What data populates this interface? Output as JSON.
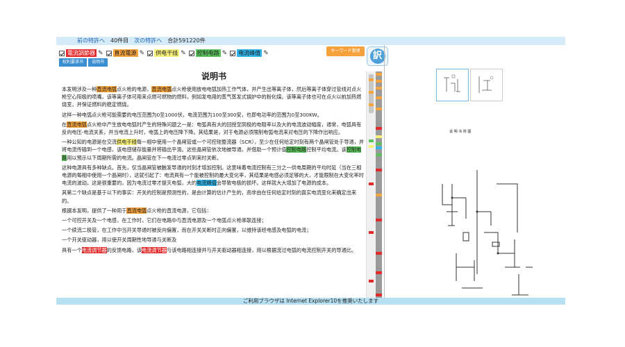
{
  "nav": {
    "prev": "前の特許へ",
    "position": "40件目",
    "next": "次の特許へ",
    "total": "合計591220件"
  },
  "legend": [
    {
      "label": "電流調節器",
      "color": "#e32929"
    },
    {
      "label": "直流電源",
      "color": "#f6a43e"
    },
    {
      "label": "供电干线",
      "color": "#f6f07a"
    },
    {
      "label": "控制电路",
      "color": "#5bc25b"
    },
    {
      "label": "电流峰值",
      "color": "#2fb3e8"
    }
  ],
  "keyword_button": "キーワード管理",
  "translate_icon": "訳",
  "tabs": {
    "claims": "权利要求书",
    "description": "说明书"
  },
  "doc": {
    "title": "说明书",
    "p1": {
      "a": "本发明涉及一种",
      "h1": "直流电弧",
      "b": "点火枪的电源，",
      "h2": "直流电弧",
      "c": "点火枪使用放电电弧加热工作气体，并产生出等离子体，然后等离子体穿过管线对点火枪空心阳极的喷嘴，该等离子体可用来点燃可燃物的燃料，例如发电用的蒸气蒸发式锅炉中的粉化煤。该等离子体也可在点火以前加热燃烧室，并保证燃料的稳定燃烧。"
    },
    "p2": "这样一种电弧点火枪可能需要的电压范围为0至1000伏，电流范围为100至300安，也即电功率的范围为0至300KW。",
    "p3": {
      "a": "在",
      "h1": "直流电弧",
      "b": "点火枪中产生放电电弧时产生的特殊问题之一是：电弧具有大的回授至阴极的电阻率以及大的电流波动幅度，通常，电弧具有反向电压-电流关系，并当电流上升时，电弧上的电压降下降。其结果是，对于电源必须限制电弧电流来对电压的下降作出响应。"
    },
    "p4": {
      "a": "一种公知的电源是在交流",
      "h1": "供电干线",
      "b": "每一相中使用一个晶闸管或一个可控硅整流器（SCR），至少在任何给定时刻有两个晶闸管处于导通，并将电流传输到一个电感，该电感储存能量并将输出平滑。这些晶闸管依次地被导通，并借助一个预计值",
      "h2": "控制电路",
      "c": "控制平均电流。该",
      "h3": "控制电路",
      "d": "用以预示以下周期所需的电流。晶闸管在下一电流过零点到来时关断。"
    },
    "p5": {
      "a": "这种电源具有多种缺点。首先，仅当晶闸管被触发导通的时刻才增加控制。这意味着电流控制有三分之一供电周期的平均时延（当在三相电源的每相中使用一个晶闸时），这就引起了：电流具有一个能被控制的最大变化率，其结果是电感必须足够的大，才能限制在大变化率时电流的波动。这是很重要的，因为电流过零才提灭电弧，大的",
      "h1": "电流峰值",
      "b": "会导致电极的损坏。这样就大大增加了电源的成本。"
    },
    "p6": "其第二个缺点是基于以下的事实：开关的控制是预测性的，是由计算的估计产生的，而非由在任何给定时刻的真实电流变化来确定出来的。",
    "p7": {
      "a": "根据本发明，提供了一种用于",
      "h1": "直流电弧",
      "b": "点火枪的直流电源，它包括："
    },
    "p8": "一个可控开关及一个电感，在工作时，它们在电路中与直流电源及一个电弧点火枪串联连接；",
    "p9": "一个续流二极管，在工作中当开关导通时被反向偏置，而在开关关断时正向偏置，以维持该经电感及电弧的电流；",
    "p10": "一个开关驱动器，用以使开关周期性地导通与关断及",
    "p11": {
      "a": "具有一个",
      "h1": "电流调节器",
      "b": "的反馈电路，该",
      "h2": "电流调节器",
      "c": "与该电路相连接并与开关驱动器相连接，用以根据流过电弧的电流控制开关的导通比。"
    }
  },
  "right_pane": {
    "page_header": "说 明 书 附 图"
  },
  "footer": "ご利用ブラウザは Internet Explorer10を推奨いたします",
  "colors": {
    "nav_bg": "#d5ebf8",
    "footer_bg": "#b7e0f2",
    "tab_blue": "#3b8fd0",
    "keyword_orange": "#f5a13c"
  }
}
